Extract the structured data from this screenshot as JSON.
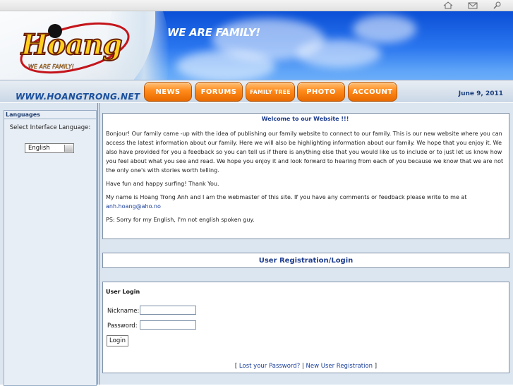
{
  "topbar": {
    "icons": [
      "home-icon",
      "mail-icon",
      "search-icon"
    ]
  },
  "header": {
    "logo_text": "Hoang",
    "logo_sub": "WE ARE FAMILY!",
    "tagline": "WE ARE FAMILY!",
    "site_url": "WWW.HOANGTRONG.NET",
    "date": "June 9, 2011",
    "nav": [
      "NEWS",
      "FORUMS",
      "FAMILY TREE",
      "PHOTO",
      "ACCOUNT"
    ]
  },
  "sidebar": {
    "heading": "Languages",
    "label": "Select Interface Language:",
    "selected_language": "English"
  },
  "welcome": {
    "title": "Welcome to our Website !!!",
    "paragraphs": [
      "Bonjour! Our family came -up with the idea of publishing our family website to connect to our family. This is our new website where you can access the latest information about our family. Here we will also be highlighting information about our family. We hope that you enjoy it. We also have provided for you a feedback so you can tell us if there is anything else that you would like us to include or to just let us know how you feel about what you see and read. We hope you enjoy it and look forward to hearing from each of you because we know that we are not the only one's with stories worth telling.",
      "Have fun and happy surfing! Thank You."
    ],
    "contact_text": "My name is Hoang Trong Anh and I am the webmaster of this site. If you have any comments or feedback please write to me at",
    "contact_email": "anh.hoang@aho.no",
    "ps": "PS: Sorry for my English, I'm not english spoken guy."
  },
  "registration": {
    "title": "User Registration/Login"
  },
  "login": {
    "title": "User Login",
    "nickname_label": "Nickname:",
    "password_label": "Password:",
    "button": "Login",
    "bracket_open": "[",
    "lost_password": "Lost your Password?",
    "separator": "|",
    "new_registration": "New User Registration",
    "bracket_close": "]"
  },
  "colors": {
    "accent_orange": "#ff8a1a",
    "link_blue": "#1a3f9a",
    "panel_bg": "#dce6f1"
  }
}
